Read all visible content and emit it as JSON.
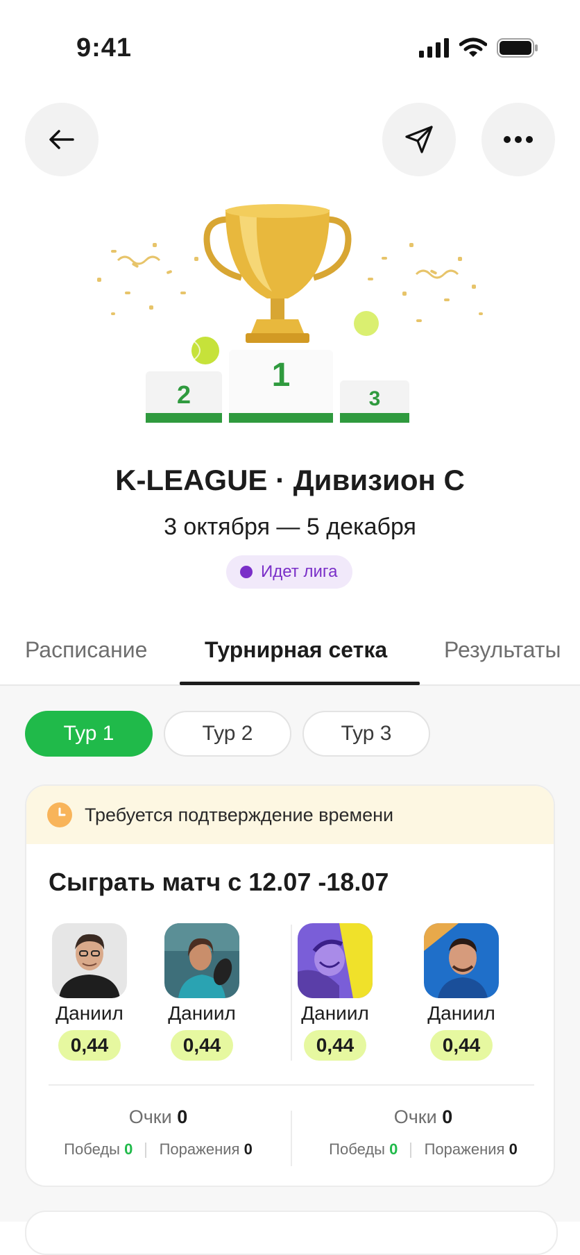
{
  "status": {
    "time": "9:41"
  },
  "league": {
    "title": "K-LEAGUE · Дивизион С",
    "dates": "3 октября — 5 декабря",
    "badge": "Идет лига",
    "podium": {
      "first": "1",
      "second": "2",
      "third": "3"
    }
  },
  "tabs": [
    {
      "label": "Расписание",
      "active": false
    },
    {
      "label": "Турнирная сетка",
      "active": true
    },
    {
      "label": "Результаты",
      "active": false
    }
  ],
  "rounds": [
    {
      "label": "Тур 1",
      "active": true
    },
    {
      "label": "Тур 2",
      "active": false
    },
    {
      "label": "Тур 3",
      "active": false
    }
  ],
  "match": {
    "warning": "Требуется подтверждение времени",
    "title": "Сыграть матч с 12.07 -18.07",
    "players": [
      {
        "name": "Даниил",
        "rating": "0,44"
      },
      {
        "name": "Даниил",
        "rating": "0,44"
      },
      {
        "name": "Даниил",
        "rating": "0,44"
      },
      {
        "name": "Даниил",
        "rating": "0,44"
      }
    ],
    "teams": [
      {
        "points_label": "Очки",
        "points": "0",
        "wins_label": "Победы",
        "wins": "0",
        "losses_label": "Поражения",
        "losses": "0"
      },
      {
        "points_label": "Очки",
        "points": "0",
        "wins_label": "Победы",
        "wins": "0",
        "losses_label": "Поражения",
        "losses": "0"
      }
    ]
  },
  "colors": {
    "accent": "#20ba4a",
    "badge": "#7a2fc8",
    "rating_bg": "#e6f8a0",
    "warning_bg": "#fdf7e2"
  }
}
